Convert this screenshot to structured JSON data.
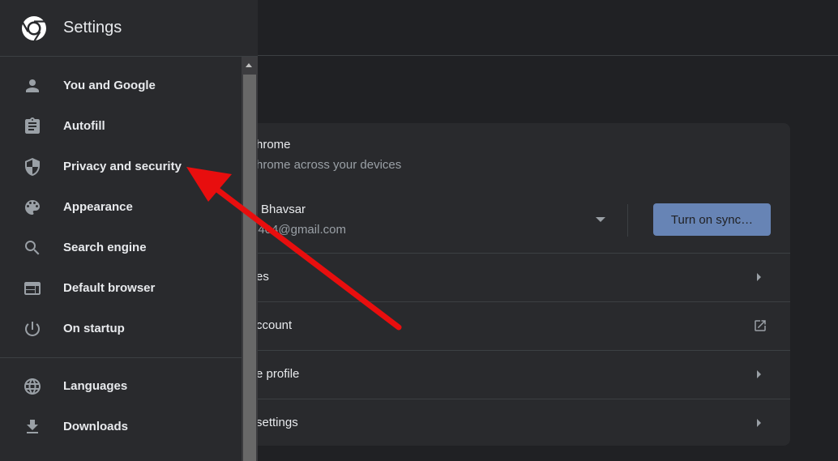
{
  "app": {
    "title": "Settings"
  },
  "sidebar": {
    "items": [
      {
        "label": "You and Google",
        "icon": "person-icon"
      },
      {
        "label": "Autofill",
        "icon": "clipboard-icon"
      },
      {
        "label": "Privacy and security",
        "icon": "shield-icon"
      },
      {
        "label": "Appearance",
        "icon": "palette-icon"
      },
      {
        "label": "Search engine",
        "icon": "search-icon"
      },
      {
        "label": "Default browser",
        "icon": "browser-window-icon"
      },
      {
        "label": "On startup",
        "icon": "power-icon"
      },
      {
        "label": "Languages",
        "icon": "globe-icon"
      },
      {
        "label": "Downloads",
        "icon": "download-icon"
      }
    ]
  },
  "card": {
    "header_title": "hrome",
    "header_subtitle": "hrome across your devices",
    "account_name": "Bhavsar",
    "account_email": "0404@gmail.com",
    "sync_button": "Turn on sync…",
    "rows": [
      {
        "label": "es",
        "icon": "chevron-right-icon"
      },
      {
        "label": "ccount",
        "icon": "external-link-icon"
      },
      {
        "label": "e profile",
        "icon": "chevron-right-icon"
      },
      {
        "label": "settings",
        "icon": "chevron-right-icon"
      }
    ]
  },
  "colors": {
    "background": "#202124",
    "surface": "#292a2d",
    "accent_button": "#6784b5",
    "annotation_arrow": "#e80e0e"
  }
}
